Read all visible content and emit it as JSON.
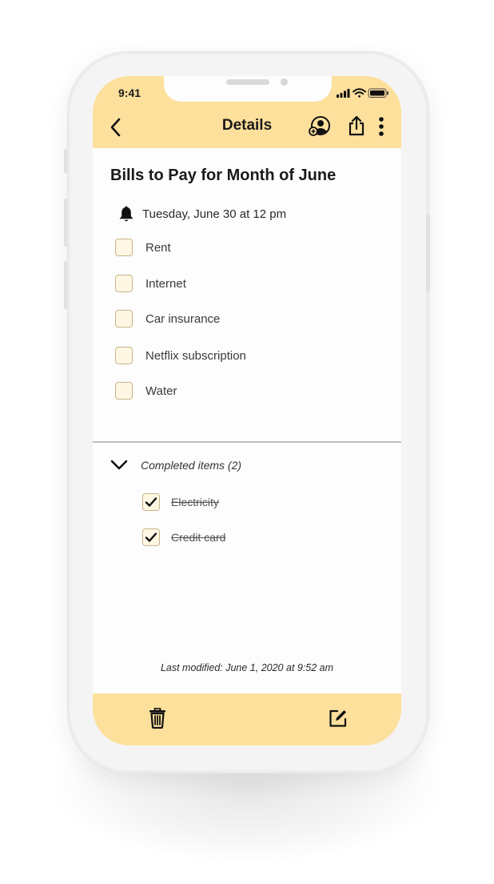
{
  "status_bar": {
    "time": "9:41"
  },
  "header": {
    "title": "Details"
  },
  "note": {
    "title": "Bills to Pay for Month of June",
    "reminder": "Tuesday, June 30 at 12 pm",
    "items": [
      {
        "label": "Rent",
        "checked": false
      },
      {
        "label": "Internet",
        "checked": false
      },
      {
        "label": "Car insurance",
        "checked": false
      },
      {
        "label": "Netflix subscription",
        "checked": false
      },
      {
        "label": "Water",
        "checked": false
      }
    ],
    "completed_header": "Completed items (2)",
    "completed_items": [
      {
        "label": "Electricity",
        "checked": true
      },
      {
        "label": "Credit card",
        "checked": true
      }
    ],
    "last_modified": "Last modified: June 1, 2020 at 9:52 am"
  },
  "colors": {
    "accent": "#fde09c",
    "checkbox_fill": "#fff7e3",
    "checkbox_border": "#c9b48b",
    "divider": "#bdbdbd"
  },
  "icons": {
    "header_left": "back-chevron-icon",
    "header_right": [
      "share-contact-icon",
      "share-icon",
      "more-vertical-icon"
    ],
    "reminder": "bell-icon",
    "completed_toggle": "chevron-down-icon",
    "bottom_left": "trash-icon",
    "bottom_right": "edit-icon"
  }
}
